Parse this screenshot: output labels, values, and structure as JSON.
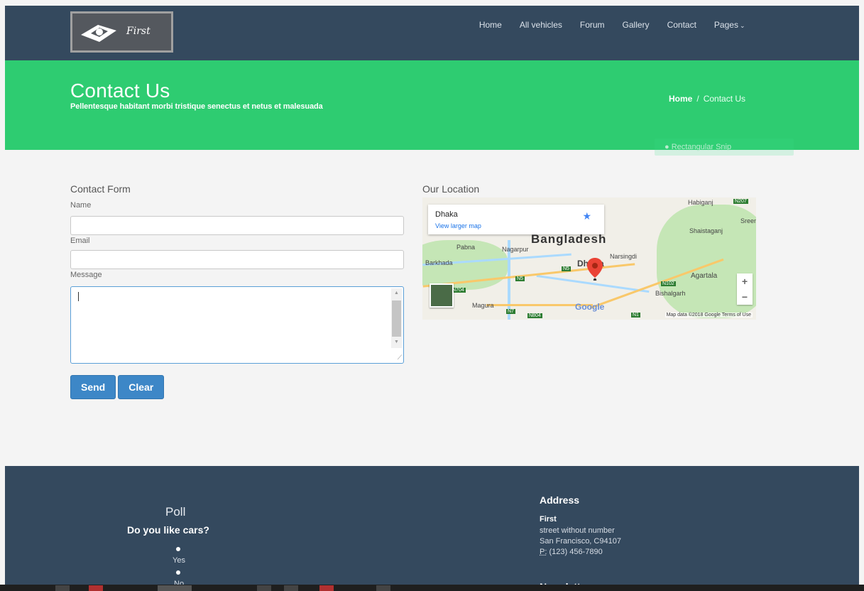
{
  "header": {
    "logo_text": "First",
    "nav": [
      {
        "label": "Home"
      },
      {
        "label": "All vehicles"
      },
      {
        "label": "Forum"
      },
      {
        "label": "Gallery"
      },
      {
        "label": "Contact"
      },
      {
        "label": "Pages"
      }
    ],
    "caret_icon": "chevron-down-icon"
  },
  "hero": {
    "title": "Contact Us",
    "subtitle": "Pellentesque habitant morbi tristique senectus et netus et malesuada",
    "breadcrumb_home": "Home",
    "breadcrumb_sep": "/",
    "breadcrumb_current": "Contact Us",
    "snip_overlay": "Rectangular Snip"
  },
  "form": {
    "title": "Contact Form",
    "name_label": "Name",
    "name_value": "",
    "email_label": "Email",
    "email_value": "",
    "message_label": "Message",
    "message_value": "",
    "send_label": "Send",
    "clear_label": "Clear"
  },
  "location": {
    "title": "Our Location",
    "card_city": "Dhaka",
    "card_link": "View larger map",
    "country": "Bangladesh",
    "places": [
      "Habiganj",
      "Pabna",
      "Nagarpur",
      "Barkhada",
      "Narsingdi",
      "Shaistaganj",
      "Agartala",
      "Bishalgarh",
      "Magura",
      "Sreem"
    ],
    "city_short": "Dh",
    "city_suffix": "a",
    "roads": [
      "N5",
      "N5",
      "N704",
      "N7",
      "N804",
      "N1",
      "N102",
      "N207"
    ],
    "google_label": "Google",
    "attribution": "Map data ©2018 Google   Terms of Use",
    "zoom_in": "+",
    "zoom_out": "−"
  },
  "footer": {
    "poll_title": "Poll",
    "poll_question": "Do you like cars?",
    "poll_options": [
      "Yes",
      "No"
    ],
    "address_heading": "Address",
    "address_name": "First",
    "address_line1": "street without number",
    "address_line2": "San Francisco, C94107",
    "phone_prefix": "P:",
    "phone": "(123) 456-7890",
    "newsletter_heading": "Newsletter"
  },
  "colors": {
    "header_bg": "#34495e",
    "hero_bg": "#2ecc71",
    "button_bg": "#3d87c7",
    "page_bg": "#f4f4f4"
  }
}
